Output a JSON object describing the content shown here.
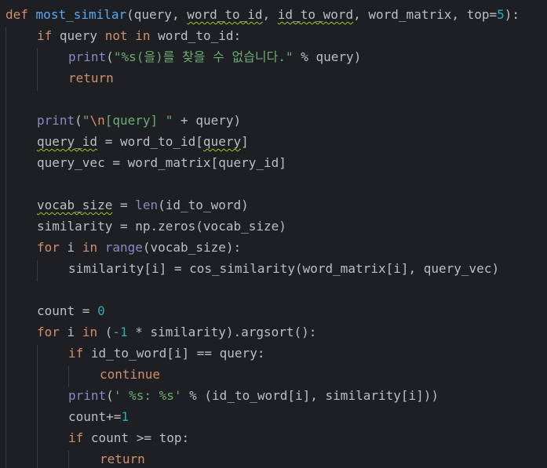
{
  "code": {
    "l1": {
      "kw": "def",
      "fname": "most_similar",
      "p1": "(query, ",
      "a1": "word_to_id",
      "p2": ", ",
      "a2": "id_to_word",
      "p3": ", word_matrix, top=",
      "num": "5",
      "p4": "):"
    },
    "l2": {
      "kw1": "if",
      "t1": " query ",
      "kw2": "not",
      "t2": " ",
      "kw3": "in",
      "t3": " word_to_id:"
    },
    "l3": {
      "bi": "print",
      "t1": "(",
      "s1": "\"%s(을)를 찾을 수 없습니다.\"",
      "t2": " % query)"
    },
    "l4": {
      "kw": "return"
    },
    "l6": {
      "bi": "print",
      "t1": "(",
      "s1": "\"",
      "esc": "\\n",
      "s2": "[query] \"",
      "t2": " + query)"
    },
    "l7": {
      "v1": "query_id",
      "t1": " = word_to_id[",
      "v2": "query",
      "t2": "]"
    },
    "l8": {
      "t1": "query_vec = word_matrix[query_id]"
    },
    "l10": {
      "v1": "vocab_size",
      "t1": " = ",
      "bi": "len",
      "t2": "(id_to_word)"
    },
    "l11": {
      "t1": "similarity = np.zeros(vocab_size)"
    },
    "l12": {
      "kw1": "for",
      "t1": " i ",
      "kw2": "in",
      "t2": " ",
      "bi": "range",
      "t3": "(vocab_size):"
    },
    "l13": {
      "t1": "similarity[i] = cos_similarity(word_matrix[i], query_vec)"
    },
    "l15": {
      "t1": "count = ",
      "num": "0"
    },
    "l16": {
      "kw1": "for",
      "t1": " i ",
      "kw2": "in",
      "t2": " (",
      "num": "-1",
      "t3": " * similarity).argsort():"
    },
    "l17": {
      "kw": "if",
      "t1": " id_to_word[i] == query:"
    },
    "l18": {
      "kw": "continue"
    },
    "l19": {
      "bi": "print",
      "t1": "(",
      "s1": "' %s: %s'",
      "t2": " % (id_to_word[i], similarity[i]))"
    },
    "l20": {
      "t1": "count+=",
      "num": "1"
    },
    "l21": {
      "kw": "if",
      "t1": " count >= top:"
    },
    "l22": {
      "kw": "return"
    }
  },
  "colors": {
    "background": "#1e1f22",
    "keyword": "#cf8e6d",
    "function_def": "#56a8f5",
    "builtin": "#8888c6",
    "string": "#6aab73",
    "number": "#2aacb8",
    "default_text": "#bcbec4",
    "indent_guide": "#393b40",
    "typo_squiggle": "#a8c023"
  }
}
